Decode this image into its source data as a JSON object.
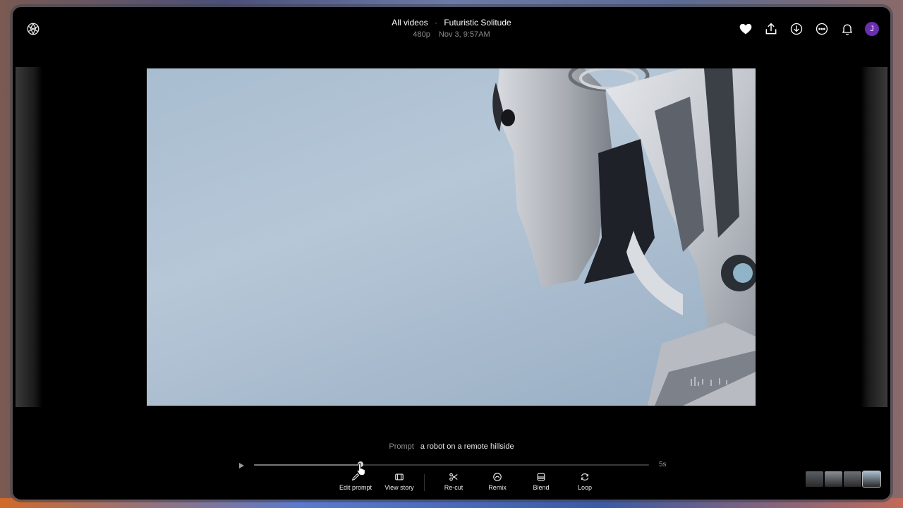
{
  "header": {
    "breadcrumb_root": "All videos",
    "separator": "·",
    "title": "Futuristic Solitude",
    "resolution": "480p",
    "timestamp": "Nov 3, 9:57AM"
  },
  "top_actions": {
    "icons": [
      "heart-icon",
      "share-icon",
      "download-icon",
      "more-icon",
      "bell-icon"
    ],
    "avatar_initial": "J",
    "avatar_color": "#6a2fb0"
  },
  "prompt": {
    "label": "Prompt",
    "text": "a robot on a remote hillside"
  },
  "player": {
    "progress": 0.27,
    "duration": "5s"
  },
  "toolbar": {
    "edit_prompt": "Edit prompt",
    "view_story": "View story",
    "recut": "Re-cut",
    "remix": "Remix",
    "blend": "Blend",
    "loop": "Loop"
  },
  "thumbnails": {
    "colors": [
      "#5a5f66",
      "#8a9096",
      "#6c7178",
      "#a9c0d0"
    ],
    "active_index": 3
  }
}
